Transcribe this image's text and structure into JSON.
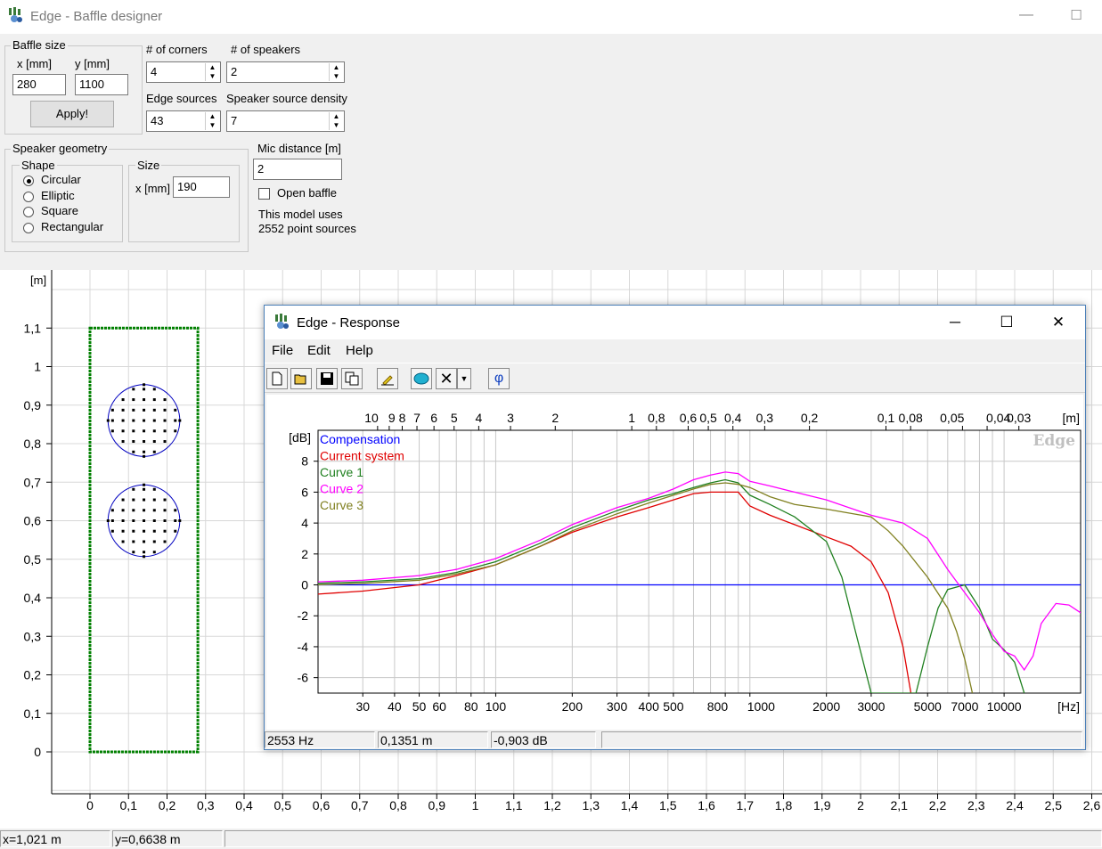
{
  "main_window": {
    "title": "Edge - Baffle designer",
    "minimize": "—",
    "maximize": "☐"
  },
  "baffle_size": {
    "group_label": "Baffle size",
    "x_label": "x [mm]",
    "y_label": "y [mm]",
    "x_value": "280",
    "y_value": "1100",
    "apply_label": "Apply!"
  },
  "corners": {
    "label": "# of corners",
    "value": "4"
  },
  "speakers": {
    "label": "# of speakers",
    "value": "2"
  },
  "edge_sources": {
    "label": "Edge sources",
    "value": "43"
  },
  "speaker_density": {
    "label": "Speaker source density",
    "value": "7"
  },
  "speaker_geometry": {
    "group_label": "Speaker geometry",
    "shape_label": "Shape",
    "shapes": [
      "Circular",
      "Elliptic",
      "Square",
      "Rectangular"
    ],
    "selected_shape": "Circular",
    "size_label": "Size",
    "size_x_label": "x [mm]",
    "size_x_value": "190"
  },
  "mic": {
    "label": "Mic distance [m]",
    "value": "2"
  },
  "open_baffle": {
    "label": "Open baffle",
    "checked": false
  },
  "model_info": {
    "line1": "This model uses",
    "line2": "2552 point sources"
  },
  "baffle_plot": {
    "y_unit": "[m]",
    "y_ticks": [
      "0",
      "0,1",
      "0,2",
      "0,3",
      "0,4",
      "0,5",
      "0,6",
      "0,7",
      "0,8",
      "0,9",
      "1",
      "1,1"
    ],
    "x_ticks": [
      "0",
      "0,1",
      "0,2",
      "0,3",
      "0,4",
      "0,5",
      "0,6",
      "0,7",
      "0,8",
      "0,9",
      "1",
      "1,1",
      "1,2",
      "1,3",
      "1,4",
      "1,5",
      "1,6",
      "1,7",
      "1,8",
      "1,9",
      "2",
      "2,1",
      "2,2",
      "2,3",
      "2,4",
      "2,5",
      "2,6"
    ],
    "baffle_w": 0.28,
    "baffle_h": 1.1,
    "speaker_centers": [
      [
        0.14,
        0.86
      ],
      [
        0.14,
        0.6
      ]
    ],
    "speaker_radius": 0.095,
    "edge_color": "#008000",
    "speaker_color": "#0000c0"
  },
  "status": {
    "x": "x=1,021 m",
    "y": "y=0,6638 m"
  },
  "response_window": {
    "title": "Edge - Response",
    "menu": [
      "File",
      "Edit",
      "Help"
    ],
    "toolbar": [
      "new-icon",
      "open-icon",
      "save-icon",
      "copy-icon",
      "pen-icon",
      "speaker-icon",
      "delete-icon",
      "dropdown-icon",
      "phase-icon"
    ],
    "phase_glyph": "φ",
    "watermark": "Edge",
    "status": {
      "freq": "2553 Hz",
      "dist": "0,1351 m",
      "level": "-0,903 dB"
    }
  },
  "chart_data": {
    "type": "line",
    "xlabel": "[Hz]",
    "ylabel": "[dB]",
    "top_axis_label": "[m]",
    "x_scale": "log",
    "xlim": [
      20,
      20000
    ],
    "ylim": [
      -7,
      10
    ],
    "x_tick_labels": [
      "30",
      "40",
      "50",
      "60",
      "80",
      "100",
      "200",
      "300",
      "400",
      "500",
      "800",
      "1000",
      "2000",
      "3000",
      "5000",
      "7000",
      "10000"
    ],
    "y_tick_labels": [
      "8",
      "6",
      "4",
      "2",
      "0",
      "-2",
      "-4",
      "-6"
    ],
    "top_tick_labels": [
      "10",
      "9",
      "8",
      "7",
      "6",
      "5",
      "4",
      "3",
      "2",
      "1",
      "0,8",
      "0,6",
      "0,5",
      "0,4",
      "0,3",
      "0,2",
      "0,1",
      "0,08",
      "0,05",
      "0,04",
      "0,03"
    ],
    "grid": true,
    "legend_position": "top-left",
    "series": [
      {
        "name": "Compensation",
        "color": "#0000ff",
        "x": [
          20,
          20000
        ],
        "y": [
          0,
          0
        ]
      },
      {
        "name": "Current system",
        "color": "#e00000",
        "x": [
          20,
          30,
          50,
          70,
          100,
          150,
          200,
          300,
          400,
          500,
          600,
          700,
          800,
          900,
          1000,
          1200,
          1500,
          2000,
          2500,
          3000,
          3500,
          4000,
          4300
        ],
        "y": [
          -0.6,
          -0.4,
          0,
          0.6,
          1.3,
          2.5,
          3.4,
          4.4,
          5.0,
          5.5,
          5.9,
          6.0,
          6.0,
          6.0,
          5.1,
          4.5,
          3.9,
          3.1,
          2.5,
          1.5,
          -0.5,
          -4,
          -7
        ]
      },
      {
        "name": "Curve 1",
        "color": "#208020",
        "x": [
          20,
          30,
          50,
          70,
          100,
          150,
          200,
          300,
          400,
          500,
          600,
          700,
          800,
          900,
          1000,
          1200,
          1500,
          2000,
          2300,
          2600,
          3000,
          3300,
          4500,
          5000,
          5500,
          6000,
          7000,
          8000,
          9000,
          10000,
          11000,
          12000
        ],
        "y": [
          0.1,
          0.2,
          0.4,
          0.8,
          1.5,
          2.7,
          3.7,
          4.8,
          5.5,
          5.9,
          6.3,
          6.6,
          6.8,
          6.6,
          5.8,
          5.2,
          4.4,
          2.8,
          0.5,
          -3,
          -7,
          -7,
          -7,
          -4,
          -1.5,
          -0.3,
          0,
          -1.5,
          -3.5,
          -4.2,
          -5,
          -7
        ]
      },
      {
        "name": "Curve 2",
        "color": "#ff00ff",
        "x": [
          20,
          30,
          50,
          70,
          100,
          150,
          200,
          300,
          400,
          500,
          600,
          700,
          800,
          900,
          1000,
          1200,
          1500,
          2000,
          3000,
          4000,
          5000,
          6000,
          7000,
          8000,
          9000,
          10000,
          11000,
          12000,
          13000,
          14000,
          16000,
          18000,
          20000
        ],
        "y": [
          0.2,
          0.3,
          0.6,
          1.0,
          1.7,
          2.9,
          3.9,
          5.0,
          5.6,
          6.2,
          6.8,
          7.1,
          7.3,
          7.2,
          6.7,
          6.4,
          6.0,
          5.5,
          4.5,
          4.0,
          3.0,
          1.0,
          -0.5,
          -1.8,
          -3.2,
          -4.3,
          -4.6,
          -5.5,
          -4.6,
          -2.5,
          -1.2,
          -1.3,
          -1.8
        ]
      },
      {
        "name": "Curve 3",
        "color": "#808020",
        "x": [
          20,
          30,
          50,
          70,
          100,
          150,
          200,
          300,
          400,
          500,
          600,
          700,
          800,
          900,
          1000,
          1200,
          1500,
          2000,
          3000,
          3500,
          4000,
          5000,
          6000,
          6500,
          7000,
          7500
        ],
        "y": [
          0,
          0.1,
          0.3,
          0.7,
          1.3,
          2.5,
          3.5,
          4.6,
          5.3,
          5.8,
          6.2,
          6.5,
          6.6,
          6.5,
          6.3,
          5.7,
          5.2,
          4.9,
          4.4,
          3.5,
          2.5,
          0.5,
          -1.5,
          -3,
          -4.8,
          -7
        ]
      }
    ]
  }
}
